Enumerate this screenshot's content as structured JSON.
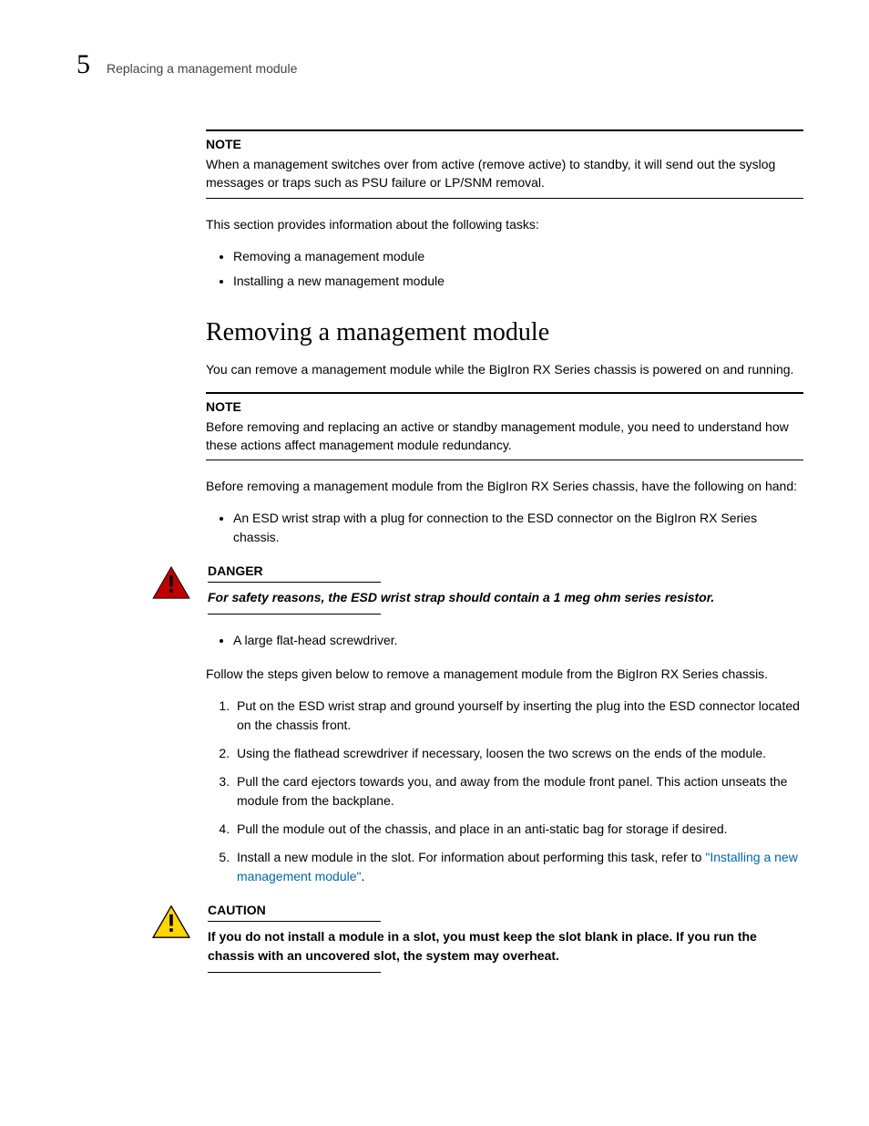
{
  "header": {
    "chapter_number": "5",
    "title": "Replacing a management module"
  },
  "note1": {
    "label": "NOTE",
    "body": "When a management switches over from active (remove active) to standby, it will send out the syslog messages or traps such as PSU failure or LP/SNM removal."
  },
  "intro_para": "This section provides information about the following tasks:",
  "intro_bullets": [
    "Removing a management module",
    "Installing a new management module"
  ],
  "section_title": "Removing a management module",
  "section_intro": "You can remove a management module while the BigIron RX Series chassis is powered on and running.",
  "note2": {
    "label": "NOTE",
    "body": "Before removing and replacing an active or standby management module, you need to understand how these actions affect management module redundancy."
  },
  "before_para": "Before removing a management module from the BigIron RX Series chassis, have the following on hand:",
  "before_bullets": [
    "An ESD wrist strap with a plug for connection to the ESD connector on the BigIron RX Series chassis."
  ],
  "danger": {
    "label": "DANGER",
    "text": "For safety reasons, the ESD wrist strap should contain a 1 meg ohm series resistor."
  },
  "after_danger_bullets": [
    "A large flat-head screwdriver."
  ],
  "follow_para": "Follow the steps given below to remove a management module from the BigIron RX Series chassis.",
  "steps": [
    "Put on the ESD wrist strap and ground yourself by inserting the plug into the ESD connector located on the chassis front.",
    "Using the flathead screwdriver if necessary, loosen the two screws on the ends of the module.",
    "Pull the card ejectors towards you, and away from the module front panel. This action unseats the module from the backplane.",
    "Pull the module out of the chassis, and place in an anti-static bag for storage if desired."
  ],
  "step5_pre": "Install a new module in the slot. For information about performing this task, refer to ",
  "step5_link": "\"Installing a new management module\"",
  "step5_post": ".",
  "caution": {
    "label": "CAUTION",
    "text": "If you do not install a module in a slot, you must keep the slot blank in place. If you run the chassis with an uncovered slot, the system may overheat."
  }
}
